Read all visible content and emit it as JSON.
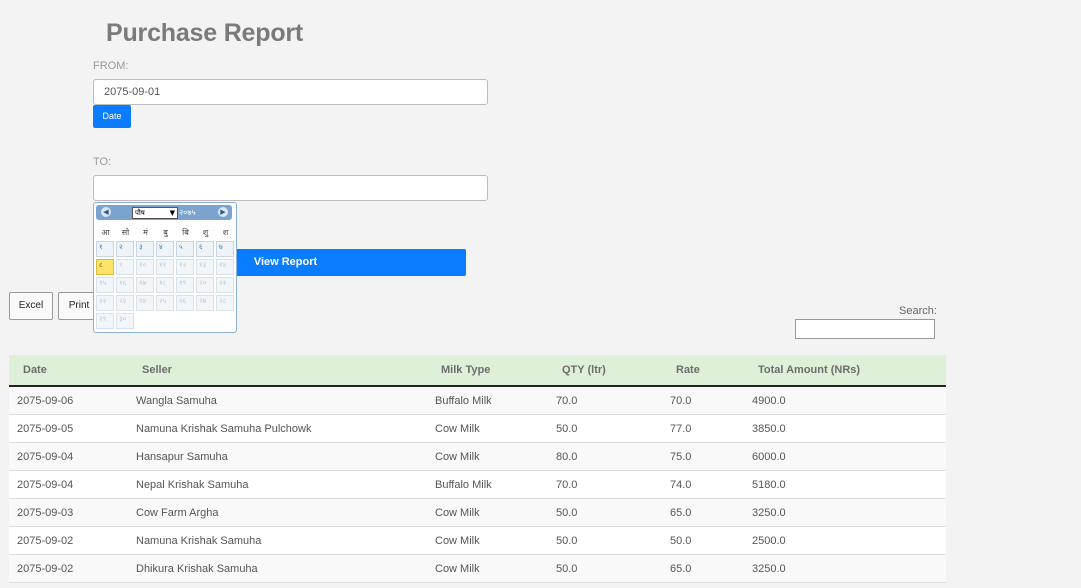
{
  "page": {
    "title": "Purchase Report"
  },
  "form": {
    "from_label": "FROM:",
    "from_value": "2075-09-01",
    "date_button": "Date",
    "to_label": "TO:",
    "to_value": "",
    "view_button": "View Report"
  },
  "calendar": {
    "prev": "◀",
    "next": "▶",
    "month": "पौष",
    "month_arrow": "▼",
    "year": "२०७५",
    "weekdays": [
      "आ",
      "सो",
      "मं",
      "बु",
      "बि",
      "शु",
      "श"
    ],
    "days": [
      "१",
      "२",
      "३",
      "४",
      "५",
      "६",
      "७",
      "८",
      "९",
      "१०",
      "११",
      "१२",
      "१३",
      "१४",
      "१५",
      "१६",
      "१७",
      "१८",
      "१९",
      "२०",
      "२१",
      "२२",
      "२३",
      "२४",
      "२५",
      "२६",
      "२७",
      "२८",
      "२९",
      "३०"
    ],
    "today": "८"
  },
  "toolbar": {
    "excel": "Excel",
    "print": "Print",
    "search_label": "Search:"
  },
  "table": {
    "headers": [
      "Date",
      "Seller",
      "Milk Type",
      "QTY (ltr)",
      "Rate",
      "Total Amount (NRs)"
    ],
    "rows": [
      [
        "2075-09-06",
        "Wangla Samuha",
        "Buffalo Milk",
        "70.0",
        "70.0",
        "4900.0"
      ],
      [
        "2075-09-05",
        "Namuna Krishak Samuha Pulchowk",
        "Cow Milk",
        "50.0",
        "77.0",
        "3850.0"
      ],
      [
        "2075-09-04",
        "Hansapur Samuha",
        "Cow Milk",
        "80.0",
        "75.0",
        "6000.0"
      ],
      [
        "2075-09-04",
        "Nepal Krishak Samuha",
        "Buffalo Milk",
        "70.0",
        "74.0",
        "5180.0"
      ],
      [
        "2075-09-03",
        "Cow Farm Argha",
        "Cow Milk",
        "50.0",
        "65.0",
        "3250.0"
      ],
      [
        "2075-09-02",
        "Namuna Krishak Samuha",
        "Cow Milk",
        "50.0",
        "50.0",
        "2500.0"
      ],
      [
        "2075-09-02",
        "Dhikura Krishak Samuha",
        "Cow Milk",
        "50.0",
        "65.0",
        "3250.0"
      ]
    ]
  }
}
